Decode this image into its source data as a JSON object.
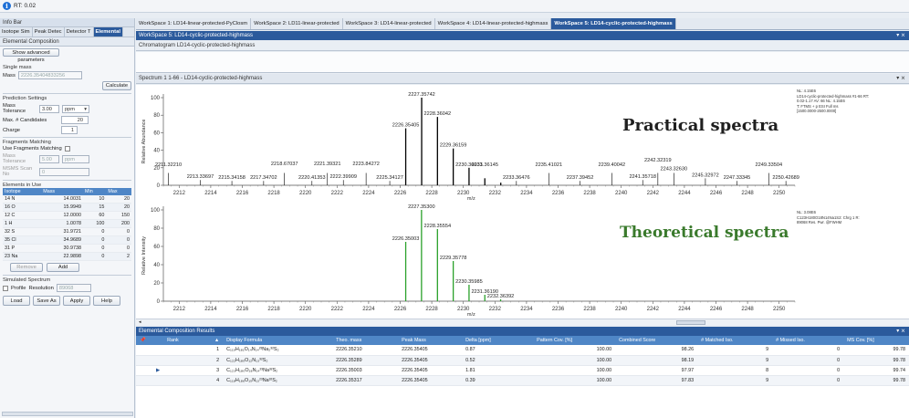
{
  "topbar": {
    "icon": "info-icon",
    "text": "RT: 0.02"
  },
  "left": {
    "panel_title": "Info Bar",
    "tabs": [
      "Isotope Sim",
      "Peak Detec",
      "Detector T",
      "Elemental"
    ],
    "section_title": "Elemental Composition",
    "show_advanced": "Show advanced parameters",
    "single_mass": "Single mass",
    "mass_label": "Mass",
    "mass_value": "2226.35404833256",
    "calculate": "Calculate",
    "prediction": "Prediction Settings",
    "mass_tol_label": "Mass Tolerance",
    "mass_tol_value": "3.00",
    "mass_tol_unit": "ppm",
    "max_cand_label": "Max. # Candidates",
    "max_cand_value": "20",
    "charge_label": "Charge",
    "charge_value": "1",
    "frag_title": "Fragments Matching",
    "use_frag": "Use Fragments Matching",
    "frag_tol_label": "Mass Tolerance",
    "frag_tol_value": "5.00",
    "frag_tol_unit": "ppm",
    "msms_label": "MSMS Scan No",
    "msms_value": "0",
    "elements_title": "Elements in Use",
    "elements_headers": [
      "Isotope",
      "Mass",
      "Min",
      "Max"
    ],
    "elements": [
      [
        "14 N",
        "14.0031",
        "10",
        "20"
      ],
      [
        "16 O",
        "15.9949",
        "15",
        "20"
      ],
      [
        "12 C",
        "12.0000",
        "60",
        "150"
      ],
      [
        "1 H",
        "1.0078",
        "100",
        "200"
      ],
      [
        "32 S",
        "31.9721",
        "0",
        "0"
      ],
      [
        "35 Cl",
        "34.9689",
        "0",
        "0"
      ],
      [
        "31 P",
        "30.9738",
        "0",
        "0"
      ],
      [
        "23 Na",
        "22.9898",
        "0",
        "2"
      ]
    ],
    "remove": "Remove",
    "add": "Add",
    "sim_title": "Simulated Spectrum",
    "profile": "Profile",
    "resolution_label": "Resolution",
    "resolution_value": "89068",
    "load": "Load",
    "save_as": "Save As",
    "apply": "Apply",
    "help": "Help"
  },
  "workspace_tabs": [
    "WorkSpace 1: LD14-linear-protected-PyClosm",
    "WorkSpace 2: LD11-linear-protected",
    "WorkSpace 3: LD14-linear-protected",
    "WorkSpace 4: LD14-linear-protected-highmass",
    "WorkSpace 5: LD14-cyclic-protected-highmass"
  ],
  "ws_title": "WorkSpace 5: LD14-cyclic-protected-highmass",
  "chromatogram_title": "Chromatogram LD14-cyclic-protected-highmass",
  "spectrum_title": "Spectrum 1 1-66 - LD14-cyclic-protected-highmass",
  "practical_label": "Practical spectra",
  "theoretical_label": "Theoretical spectra",
  "info_top": [
    "NL: 4.15E6",
    "LD14-cyclic-protected-highmass #1-66 RT:",
    "0.02-1.17 AV: 66 NL: 4.15E6",
    "T: FTMS + p ESI Full ms",
    "[1500.0000-2500.0000]"
  ],
  "info_bottom": [
    "NL: 3.08E6",
    "C123H180O18N14Na1S2: Chrg 1 R:",
    "89068 Res. Pwr. @FWHM"
  ],
  "ylabel_top": "Relative Abundance",
  "ylabel_bottom": "Relative Intensity",
  "xlabel": "m/z",
  "results_title": "Elemental Composition Results",
  "results_headers": [
    "Rank",
    "Display Formula",
    "Theo. mass",
    "Peak Mass",
    "Delta [ppm]",
    "Pattern Cov. [%]",
    "Combined Score",
    "# Matched Iso.",
    "# Missed Iso.",
    "MS Cov. [%]"
  ],
  "results": [
    [
      "1",
      "C₁₁₉H₁₈₁O₁₄N₁₄²³Na₂³²S₂",
      "2226.35210",
      "2226.35405",
      "0.87",
      "100.00",
      "98.26",
      "9",
      "0",
      "99.78"
    ],
    [
      "2",
      "C₁₂₂H₁₈₅O₁₂N₁₃³²S₂",
      "2226.35289",
      "2226.35405",
      "0.52",
      "100.00",
      "98.19",
      "9",
      "0",
      "99.78"
    ],
    [
      "3",
      "C₁₂₃H₁₈₀O₁₈N₁₄²³Na³²S₂",
      "2226.35003",
      "2226.35405",
      "1.81",
      "100.00",
      "97.97",
      "8",
      "0",
      "99.74"
    ],
    [
      "4",
      "C₁₁₈H₁₈₆O₁₅N₁₃²³Na³²S₂",
      "2226.35317",
      "2226.35405",
      "0.39",
      "100.00",
      "97.83",
      "9",
      "0",
      "99.78"
    ]
  ],
  "chart_data": [
    {
      "type": "bar",
      "title": "Practical spectra",
      "xlabel": "m/z",
      "ylabel": "Relative Abundance",
      "xlim": [
        2211,
        2251
      ],
      "ylim": [
        0,
        100
      ],
      "x_ticks": [
        "2212",
        "2214",
        "2216",
        "2218",
        "2220",
        "2222",
        "2224",
        "2226",
        "2228",
        "2230",
        "2232",
        "2234",
        "2236",
        "2238",
        "2240",
        "2242",
        "2244",
        "2246",
        "2248",
        "2250"
      ],
      "y_ticks": [
        "0",
        "20",
        "40",
        "60",
        "80",
        "100"
      ],
      "labels": [
        {
          "mz": "2211.32210",
          "x": 2211.32,
          "y": 20
        },
        {
          "mz": "2213.33697",
          "x": 2213.34,
          "y": 6
        },
        {
          "mz": "2215.34158",
          "x": 2215.34,
          "y": 5
        },
        {
          "mz": "2217.34702",
          "x": 2217.35,
          "y": 5
        },
        {
          "mz": "2218.67037",
          "x": 2218.67,
          "y": 21
        },
        {
          "mz": "2220.41353",
          "x": 2220.41,
          "y": 5
        },
        {
          "mz": "2221.39321",
          "x": 2221.39,
          "y": 21
        },
        {
          "mz": "2222.39909",
          "x": 2222.4,
          "y": 6
        },
        {
          "mz": "2223.84272",
          "x": 2223.84,
          "y": 21
        },
        {
          "mz": "2225.34127",
          "x": 2225.34,
          "y": 5
        },
        {
          "mz": "2226.35405",
          "x": 2226.35,
          "y": 65
        },
        {
          "mz": "2227.35742",
          "x": 2227.36,
          "y": 100
        },
        {
          "mz": "2228.36042",
          "x": 2228.36,
          "y": 78
        },
        {
          "mz": "2229.36159",
          "x": 2229.36,
          "y": 42
        },
        {
          "mz": "2230.36033",
          "x": 2230.36,
          "y": 20
        },
        {
          "mz": "2231.36145",
          "x": 2231.36,
          "y": 20
        },
        {
          "mz": "2233.36476",
          "x": 2233.36,
          "y": 5
        },
        {
          "mz": "2235.41021",
          "x": 2235.41,
          "y": 20
        },
        {
          "mz": "2237.39452",
          "x": 2237.39,
          "y": 5
        },
        {
          "mz": "2239.40042",
          "x": 2239.4,
          "y": 20
        },
        {
          "mz": "2241.35718",
          "x": 2241.36,
          "y": 6
        },
        {
          "mz": "2242.32319",
          "x": 2242.32,
          "y": 25
        },
        {
          "mz": "2243.32630",
          "x": 2243.33,
          "y": 15
        },
        {
          "mz": "2245.32972",
          "x": 2245.33,
          "y": 8
        },
        {
          "mz": "2247.33345",
          "x": 2247.33,
          "y": 5
        },
        {
          "mz": "2249.33504",
          "x": 2249.34,
          "y": 20
        },
        {
          "mz": "2250.42689",
          "x": 2250.43,
          "y": 5
        }
      ],
      "peaks": [
        {
          "x": 2226.35,
          "y": 65
        },
        {
          "x": 2227.36,
          "y": 100
        },
        {
          "x": 2228.36,
          "y": 78
        },
        {
          "x": 2229.36,
          "y": 42
        },
        {
          "x": 2230.36,
          "y": 20
        },
        {
          "x": 2231.36,
          "y": 8
        },
        {
          "x": 2232.37,
          "y": 3
        }
      ]
    },
    {
      "type": "bar",
      "title": "Theoretical spectra",
      "xlabel": "m/z",
      "ylabel": "Relative Intensity",
      "xlim": [
        2211,
        2251
      ],
      "ylim": [
        0,
        100
      ],
      "x_ticks": [
        "2212",
        "2214",
        "2216",
        "2218",
        "2220",
        "2222",
        "2224",
        "2226",
        "2228",
        "2230",
        "2232",
        "2234",
        "2236",
        "2238",
        "2240",
        "2242",
        "2244",
        "2246",
        "2248",
        "2250"
      ],
      "y_ticks": [
        "0",
        "20",
        "40",
        "60",
        "80",
        "100"
      ],
      "labels": [
        {
          "mz": "2226.35003",
          "x": 2226.35,
          "y": 65
        },
        {
          "mz": "2227.35300",
          "x": 2227.35,
          "y": 100
        },
        {
          "mz": "2228.35554",
          "x": 2228.36,
          "y": 79
        },
        {
          "mz": "2229.35778",
          "x": 2229.36,
          "y": 44
        },
        {
          "mz": "2230.35985",
          "x": 2230.36,
          "y": 18
        },
        {
          "mz": "2231.36190",
          "x": 2231.36,
          "y": 7
        },
        {
          "mz": "2232.36392",
          "x": 2232.36,
          "y": 2
        }
      ],
      "peaks": [
        {
          "x": 2226.35,
          "y": 65
        },
        {
          "x": 2227.35,
          "y": 100
        },
        {
          "x": 2228.36,
          "y": 79
        },
        {
          "x": 2229.36,
          "y": 44
        },
        {
          "x": 2230.36,
          "y": 18
        },
        {
          "x": 2231.36,
          "y": 7
        },
        {
          "x": 2232.36,
          "y": 2
        }
      ]
    }
  ]
}
